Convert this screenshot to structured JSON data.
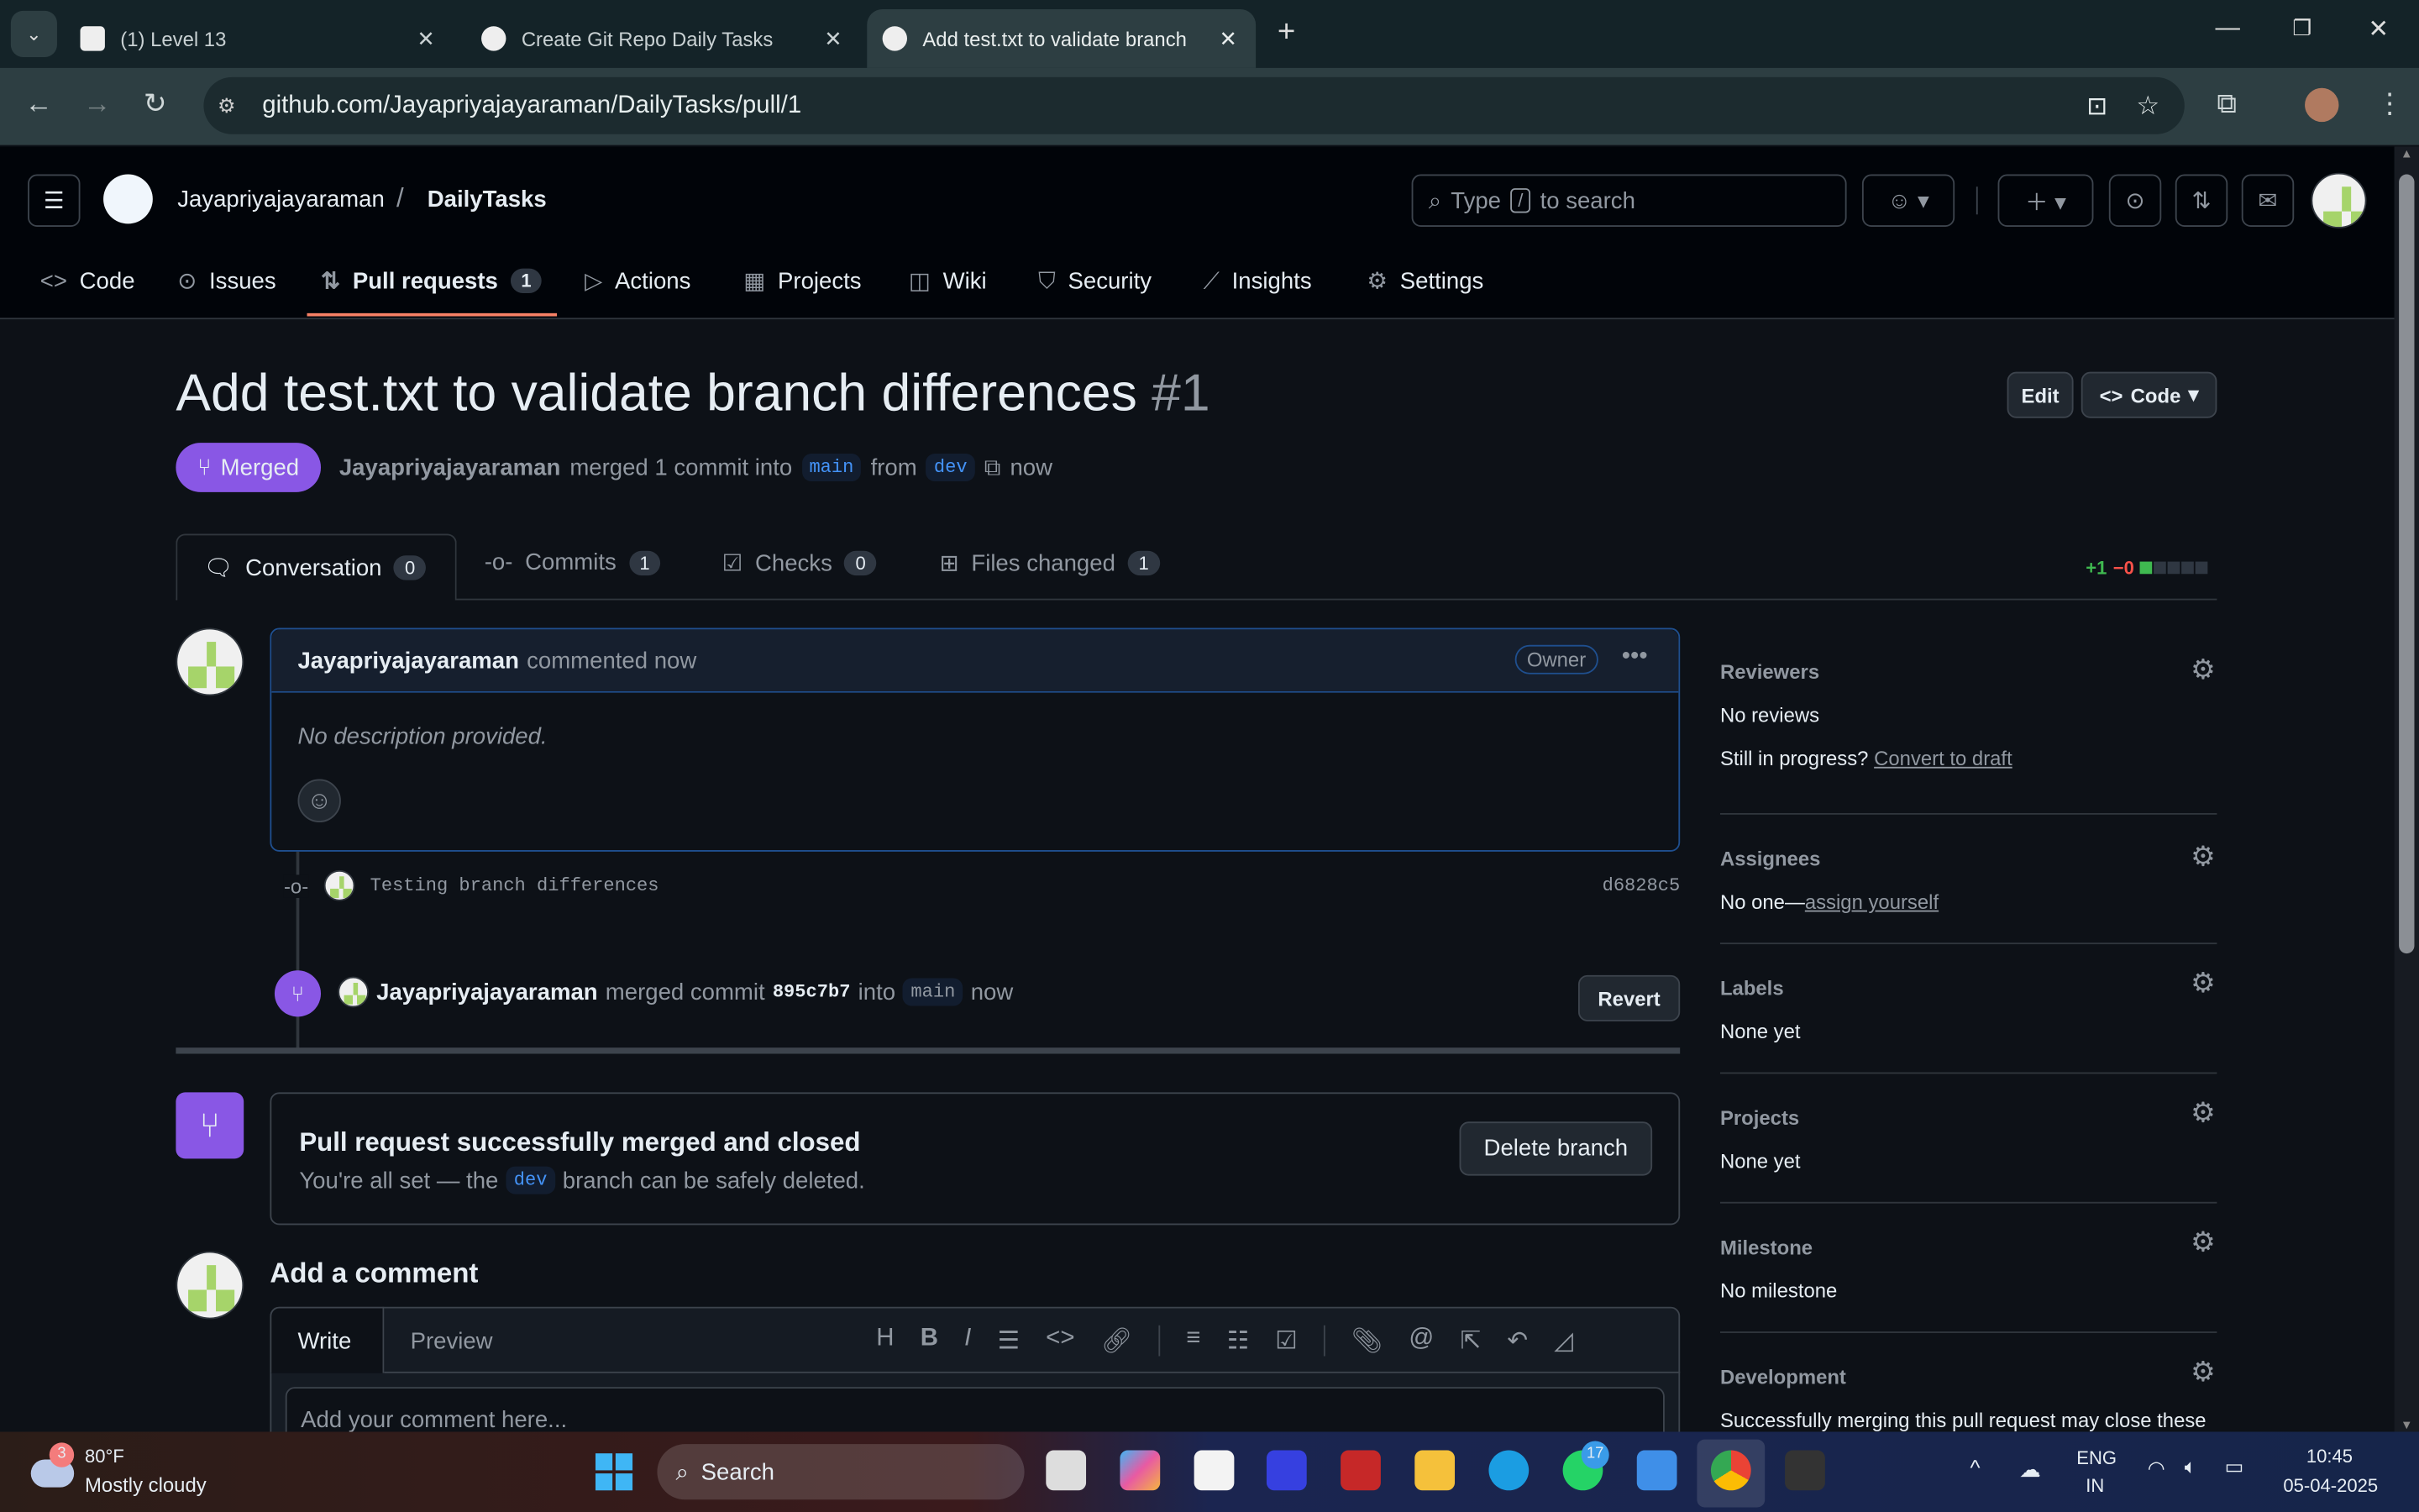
{
  "browser": {
    "tabs": [
      {
        "title": "(1) Level 13",
        "active": false
      },
      {
        "title": "Create Git Repo Daily Tasks",
        "active": false
      },
      {
        "title": "Add test.txt to validate branch differences",
        "active": true
      }
    ],
    "url": "github.com/Jayapriyajayaraman/DailyTasks/pull/1"
  },
  "header": {
    "owner": "Jayapriyajayaraman",
    "separator": "/",
    "repo": "DailyTasks",
    "search_prefix": "Type",
    "search_key": "/",
    "search_suffix": "to search"
  },
  "repo_nav": [
    {
      "label": "Code",
      "icon": "code-icon"
    },
    {
      "label": "Issues",
      "icon": "issue-icon"
    },
    {
      "label": "Pull requests",
      "icon": "pull-request-icon",
      "count": "1",
      "active": true
    },
    {
      "label": "Actions",
      "icon": "play-icon"
    },
    {
      "label": "Projects",
      "icon": "table-icon"
    },
    {
      "label": "Wiki",
      "icon": "book-icon"
    },
    {
      "label": "Security",
      "icon": "shield-icon"
    },
    {
      "label": "Insights",
      "icon": "graph-icon"
    },
    {
      "label": "Settings",
      "icon": "gear-icon"
    }
  ],
  "pr": {
    "title": "Add test.txt to validate branch differences",
    "number": "#1",
    "edit_label": "Edit",
    "code_label": "Code",
    "state": "Merged",
    "author": "Jayapriyajayaraman",
    "summary": "merged 1 commit into",
    "base": "main",
    "from": "from",
    "head": "dev",
    "time": "now",
    "tabs": [
      {
        "label": "Conversation",
        "count": "0",
        "active": true
      },
      {
        "label": "Commits",
        "count": "1"
      },
      {
        "label": "Checks",
        "count": "0"
      },
      {
        "label": "Files changed",
        "count": "1"
      }
    ],
    "additions": "+1",
    "deletions": "−0",
    "diff_blocks_added": 1,
    "diff_blocks_total": 5,
    "colors": {
      "merged": "#8957e5",
      "add": "#3fb950",
      "del": "#f85149",
      "link": "#4493f8"
    }
  },
  "comment": {
    "author": "Jayapriyajayaraman",
    "action": "commented now",
    "badge": "Owner",
    "body": "No description provided."
  },
  "commit": {
    "message": "Testing branch differences",
    "sha": "d6828c5"
  },
  "merge_event": {
    "author": "Jayapriyajayaraman",
    "text1": "merged commit",
    "sha": "895c7b7",
    "text2": "into",
    "branch": "main",
    "time": "now",
    "revert_label": "Revert"
  },
  "merge_box": {
    "title": "Pull request successfully merged and closed",
    "desc1": "You're all set — the",
    "branch": "dev",
    "desc2": "branch can be safely deleted.",
    "button": "Delete branch"
  },
  "add_comment": {
    "heading": "Add a comment",
    "write": "Write",
    "preview": "Preview",
    "placeholder": "Add your comment here..."
  },
  "sidebar": {
    "reviewers": {
      "title": "Reviewers",
      "value": "No reviews",
      "prompt": "Still in progress?",
      "link": "Convert to draft"
    },
    "assignees": {
      "title": "Assignees",
      "value": "No one—",
      "link": "assign yourself"
    },
    "labels": {
      "title": "Labels",
      "value": "None yet"
    },
    "projects": {
      "title": "Projects",
      "value": "None yet"
    },
    "milestone": {
      "title": "Milestone",
      "value": "No milestone"
    },
    "development": {
      "title": "Development",
      "value": "Successfully merging this pull request may close these"
    }
  },
  "taskbar": {
    "weather_badge": "3",
    "temp": "80°F",
    "weather": "Mostly cloudy",
    "search": "Search",
    "whatsapp_badge": "17",
    "lang1": "ENG",
    "lang2": "IN",
    "time": "10:45",
    "date": "05-04-2025"
  }
}
